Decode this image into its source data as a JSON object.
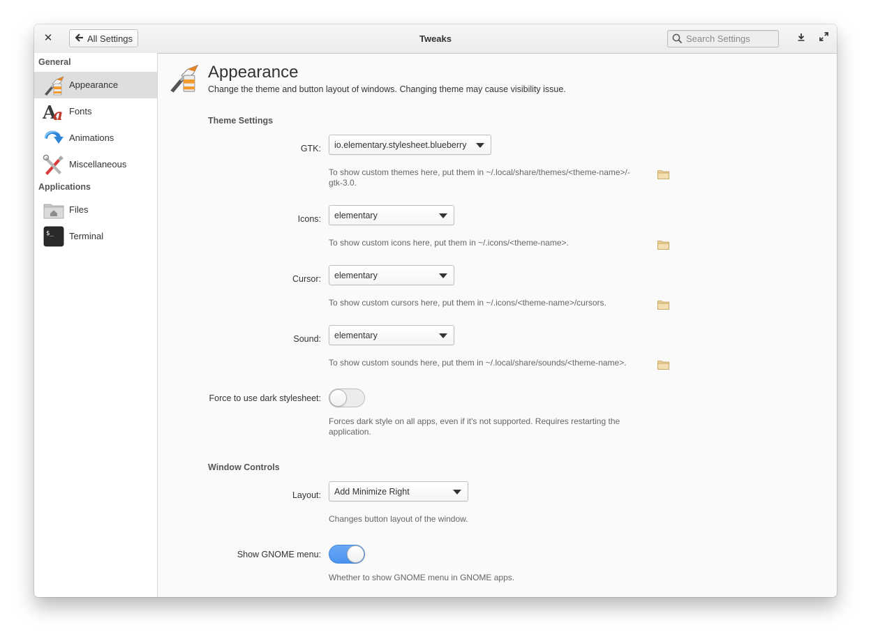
{
  "header": {
    "title": "Tweaks",
    "back_label": "All Settings",
    "search_placeholder": "Search Settings"
  },
  "sidebar": {
    "sections": [
      {
        "title": "General",
        "items": [
          {
            "label": "Appearance",
            "icon": "paint-brush-icon",
            "selected": true
          },
          {
            "label": "Fonts",
            "icon": "fonts-icon"
          },
          {
            "label": "Animations",
            "icon": "animation-arrow-icon"
          },
          {
            "label": "Miscellaneous",
            "icon": "tools-icon"
          }
        ]
      },
      {
        "title": "Applications",
        "items": [
          {
            "label": "Files",
            "icon": "home-folder-icon"
          },
          {
            "label": "Terminal",
            "icon": "terminal-icon"
          }
        ]
      }
    ]
  },
  "page": {
    "title": "Appearance",
    "description": "Change the theme and button layout of windows. Changing theme may cause visibility issue."
  },
  "theme_settings": {
    "title": "Theme Settings",
    "gtk": {
      "label": "GTK:",
      "value": "io.elementary.stylesheet.blueberry",
      "hint_line1": "To show custom themes here, put them in ~/.local/share/themes/<theme-name>/-",
      "hint_line2": "gtk-3.0."
    },
    "icons": {
      "label": "Icons:",
      "value": "elementary",
      "hint": "To show custom icons here, put them in ~/.icons/<theme-name>."
    },
    "cursor": {
      "label": "Cursor:",
      "value": "elementary",
      "hint": "To show custom cursors here, put them in ~/.icons/<theme-name>/cursors."
    },
    "sound": {
      "label": "Sound:",
      "value": "elementary",
      "hint": "To show custom sounds here, put them in ~/.local/share/sounds/<theme-name>."
    },
    "dark": {
      "label": "Force to use dark stylesheet:",
      "enabled": false,
      "hint_line1": "Forces dark style on all apps, even if it's not supported. Requires restarting the",
      "hint_line2": "application."
    }
  },
  "window_controls": {
    "title": "Window Controls",
    "layout": {
      "label": "Layout:",
      "value": "Add Minimize Right",
      "hint": "Changes button layout of the window."
    },
    "gnome_menu": {
      "label": "Show GNOME menu:",
      "enabled": true,
      "hint": "Whether to show GNOME menu in GNOME apps."
    }
  },
  "colors": {
    "accent": "#4b93f0",
    "sidebar_selected": "#dedede",
    "folder": "#e8cf98"
  }
}
